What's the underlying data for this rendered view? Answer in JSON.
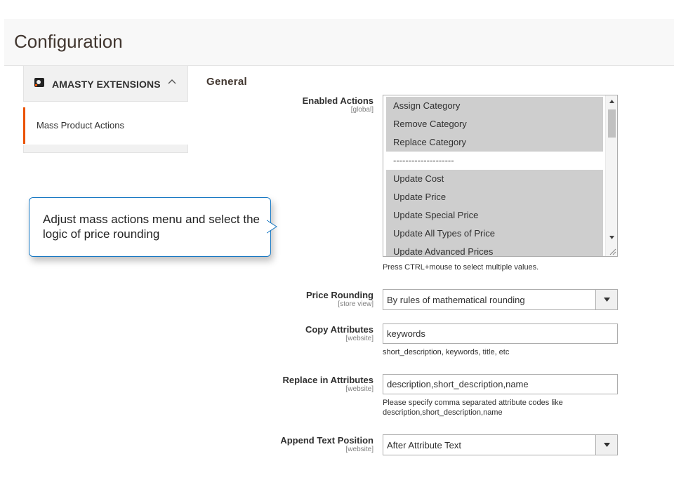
{
  "page": {
    "title": "Configuration"
  },
  "sidebar": {
    "section_title": "AMASTY EXTENSIONS",
    "items": [
      {
        "label": "Mass Product Actions",
        "active": true
      }
    ]
  },
  "callout": {
    "text": "Adjust mass actions menu and select the logic of price rounding"
  },
  "general": {
    "title": "General",
    "enabled_actions": {
      "label": "Enabled Actions",
      "scope": "[global]",
      "options": [
        {
          "label": "Assign Category",
          "selected": true
        },
        {
          "label": "Remove Category",
          "selected": true
        },
        {
          "label": "Replace Category",
          "selected": true
        },
        {
          "label": "--------------------",
          "selected": false
        },
        {
          "label": "Update Cost",
          "selected": true
        },
        {
          "label": "Update Price",
          "selected": true
        },
        {
          "label": "Update Special Price",
          "selected": true
        },
        {
          "label": "Update All Types of Price",
          "selected": true
        },
        {
          "label": "Update Advanced Prices",
          "selected": true
        }
      ],
      "note": "Press CTRL+mouse to select multiple values."
    },
    "price_rounding": {
      "label": "Price Rounding",
      "scope": "[store view]",
      "value": "By rules of mathematical rounding"
    },
    "copy_attributes": {
      "label": "Copy Attributes",
      "scope": "[website]",
      "value": "keywords",
      "note": "short_description, keywords, title, etc"
    },
    "replace_in_attributes": {
      "label": "Replace in Attributes",
      "scope": "[website]",
      "value": "description,short_description,name",
      "note_line1": "Please specify comma separated attribute codes like",
      "note_line2": "description,short_description,name"
    },
    "append_text_position": {
      "label": "Append Text Position",
      "scope": "[website]",
      "value": "After Attribute Text"
    }
  },
  "colors": {
    "accent": "#eb5202",
    "callout_border": "#1979c3",
    "selected_option": "#cecece"
  }
}
